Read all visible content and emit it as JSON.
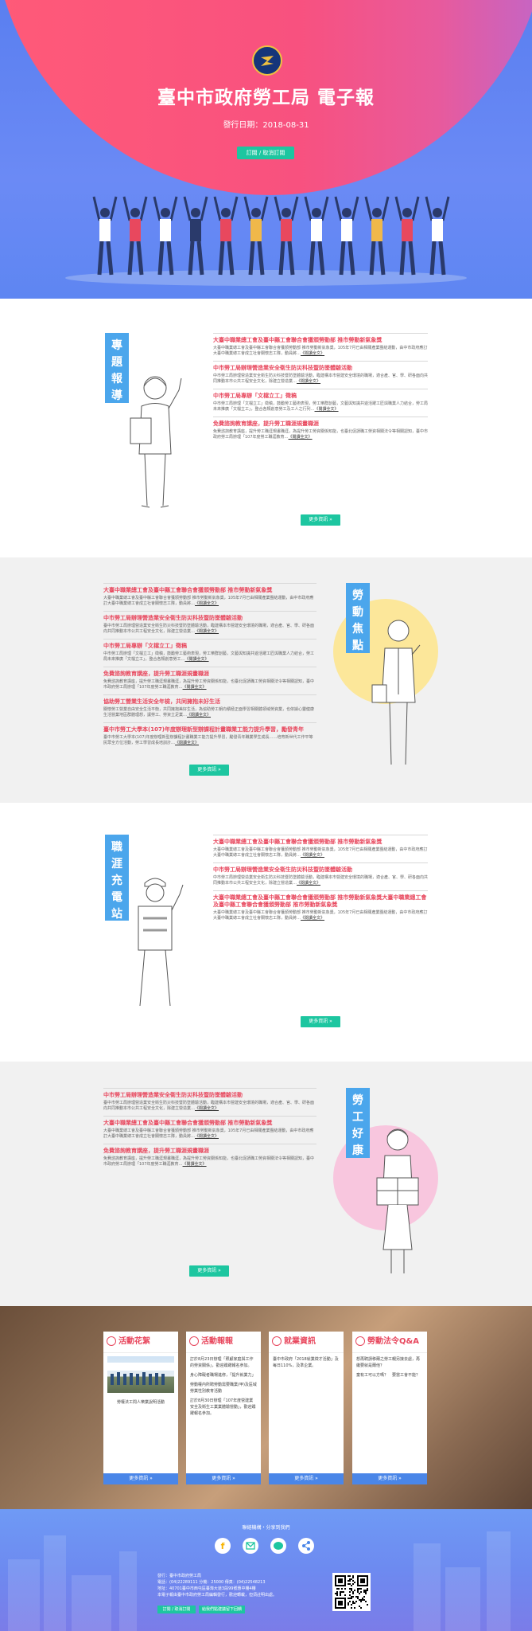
{
  "header": {
    "title": "臺中市政府勞工局 電子報",
    "issue_date": "發行日期：2018-08-31",
    "subscribe_label": "訂閱 / 取消訂閱"
  },
  "sections": {
    "feature": {
      "tag": [
        "專",
        "題",
        "報",
        "導"
      ],
      "more_label": "更多資訊 »",
      "items": [
        {
          "title": "大臺中職業總工會及臺中縣工會聯合會獲頒勞動部 推市勞動新氣象獎",
          "text": "大臺中職業總工會及臺中縣工會聯合會獲頒勞動部 推市勞動新氣象獎，105年7月已由相關產業團結運動，由中市政府應訂大臺中職業總工會成立社會關懷志工隊，動員將…",
          "link": "《閱讀全文》"
        },
        {
          "title": "中市勞工局辦理營造業安全衛生防災科技暨防墜體驗活動",
          "text": "中市勞工局辦理營造業安全衛生防災科技暨防墜體驗活動，臨建構本市營建安全環境的職場，適合產、官、學、研各面向共同推動本市公共工程安全文化，除建立營造業…",
          "link": "《閱讀全文》"
        },
        {
          "title": "中市勞工局專辦「文檔立工」徵稿",
          "text": "中市勞工局辦理「文檔立工」徵稿，鼓勵勞工藝術表現，勞工樂群創藝，文藝與知識共遊活躍工匠與職業人力結合，勞工局未來推廣「文檔立工」，整合各類創意勞工及工人之行列…",
          "link": "《閱讀全文》"
        },
        {
          "title": "免費諮詢教育講座，提升勞工職涯規畫職涯",
          "text": "免費諮詢教育講座，提升勞工職涯規畫職涯，為提升勞工勞資關係知能，也臺北促請職工勞資相關法令等相關認知，臺中市政府勞工局辦理「107年度勞工職涯教育…",
          "link": "《閱讀全文》"
        }
      ]
    },
    "labor": {
      "tag": [
        "勞",
        "動",
        "焦",
        "點"
      ],
      "more_label": "更多資訊 »",
      "items": [
        {
          "title": "大臺中職業總工會及臺中縣工會聯合會獲頒勞動部 推市勞動新氣象獎",
          "text": "大臺中職業總工會及臺中縣工會聯合會獲頒勞動部 推市勞動新氣象獎，105年7月已由相關產業團結運動，由中市政府應訂大臺中職業總工會成立社會關懷志工隊，動員將…",
          "link": "《閱讀全文》"
        },
        {
          "title": "中市勞工局辦理營造業安全衛生防災科技暨防墜體驗活動",
          "text": "臺中市勞工局辦理營造業安全衛生防災科技暨防墜體驗活動，臨建構本市營建安全環境的職場，適合產、官、學、研各面向共同推動本市公共工程安全文化，除建立營造業…",
          "link": "《閱讀全文》"
        },
        {
          "title": "中市勞工局專辦「文檔立工」徵稿",
          "text": "中市勞工局辦理「文檔立工」徵稿，鼓勵勞工藝術表現，勞工樂群創藝，文藝與知識共遊活躍工匠與職業人力結合，勞工局未來推廣「文檔立工」，整合各類創意勞工…",
          "link": "《閱讀全文》"
        },
        {
          "title": "免費諮詢教育講座，提升勞工職涯規畫職涯",
          "text": "免費諮詢教育講座，提升勞工職涯規畫職涯，為提升勞工勞資關係知能，也臺北促請職工勞資相關法令等相關認知，臺中市政府勞工局辦理「107年度勞工職涯教育…",
          "link": "《閱讀全文》"
        },
        {
          "title": "協助勞工營業生活安全年檢，共同擁抱未好生活",
          "text": "關懷勞工營業自由安全生活平衡，共同擁抱美好生活，為協助勞工朝向積極正面學習相關體領域勞資業，也依據心靈健康生活營業地區群體理想，讓勞工、勞資立足業…",
          "link": "《閱讀全文》"
        },
        {
          "title": "臺中市勞工大學本(107)年度辦理新型辦課程計畫職業工能力提升學習，勵發青年",
          "text": "臺中市勞工大學本(107)年度辦理新型辦課程計畫職業工能力提升學習，勵發青年職業學生成長……培育新世代工作平等民眾全方位活動，勞工學習成長培訓計…",
          "link": "《閱讀全文》"
        }
      ]
    },
    "career": {
      "tag": [
        "職",
        "涯",
        "充",
        "電",
        "站"
      ],
      "more_label": "更多資訊 »",
      "items": [
        {
          "title": "大臺中職業總工會及臺中縣工會聯合會獲頒勞動部 推市勞動新氣象獎",
          "text": "大臺中職業總工會及臺中縣工會聯合會獲頒勞動部 推市勞動新氣象獎，105年7月已由相關產業團結運動，由中市政府應訂大臺中職業總工會成立社會關懷志工隊，動員將…",
          "link": "《閱讀全文》"
        },
        {
          "title": "中市勞工局辦理營造業安全衛生防災科技暨防墜體驗活動",
          "text": "中市勞工局辦理營造業安全衛生防災科技暨防墜體驗活動，臨建構本市營建安全環境的職場，適合產、官、學、研各面向共同推動本市公共工程安全文化，除建立營造業…",
          "link": "《閱讀全文》"
        },
        {
          "title": "大臺中職業總工會及臺中縣工會聯合會獲頒勞動部 推市勞動新氣象獎大臺中職業總工會及臺中縣工會聯合會獲頒勞動部 推市勞動新氣象獎",
          "text": "大臺中職業總工會及臺中縣工會聯合會獲頒勞動部 推市勞動新氣象獎，105年7月已由相關產業團結運動，由中市政府應訂大臺中職業總工會成立社會關懷志工隊，動員將…",
          "link": "《閱讀全文》"
        }
      ]
    },
    "health": {
      "tag": [
        "勞",
        "工",
        "好",
        "康"
      ],
      "more_label": "更多資訊 »",
      "items": [
        {
          "title": "中市勞工局辦理營造業安全衛生防災科技暨防墜體驗活動",
          "text": "臺中市勞工局辦理營造業安全衛生防災科技暨防墜體驗活動，臨建構本市營建安全環境的職場，適合產、官、學、研各面向共同推動本市公共工程安全文化，除建立營造業…",
          "link": "《閱讀全文》"
        },
        {
          "title": "大臺中職業總工會及臺中縣工會聯合會獲頒勞動部 推市勞動新氣象獎",
          "text": "大臺中職業總工會及臺中縣工會聯合會獲頒勞動部 推市勞動新氣象獎，105年7月已由相關產業團結運動，由中市政府應訂大臺中職業總工會成立社會關懷志工隊，動員將…",
          "link": "《閱讀全文》"
        },
        {
          "title": "免費諮詢教育講座，提升勞工職涯規畫職涯",
          "text": "免費諮詢教育講座，提升勞工職涯規畫職涯，為提升勞工勞資關係知能，也臺北促請職工勞資相關法令等相關認知，臺中市政府勞工局辦理「107年度勞工職涯教育…",
          "link": "《閱讀全文》"
        }
      ]
    }
  },
  "cards": [
    {
      "title": "活動花絮",
      "icon": "camera-icon",
      "caption": "勞權法工問人樂業說明活動",
      "more_label": "更多資訊 »"
    },
    {
      "title": "活動報報",
      "icon": "megaphone-icon",
      "lines": [
        "訂於8月23日辦理「照顧家庭與工作的勞資關係」，歡迎踴躍報名參加。",
        "身心障礙者職場進修，「提升就業力」",
        "勞動權內所聘勞動需要職業(甲)及區域勞業性別教育活動",
        "訂於8月30日辦理「107年度營建業安全及衛生工業業體驗營動」，歡迎踴躍報名參加。"
      ],
      "more_label": "更多資訊 »"
    },
    {
      "title": "就業資訊",
      "icon": "briefcase-icon",
      "lines": [
        "臺中市政府「2018就業徵才活動」及每日110%，及準企業。"
      ],
      "more_label": "更多資訊 »"
    },
    {
      "title": "勞動法令Q&A",
      "icon": "scales-icon",
      "lines": [
        "想再聘請移爾之勞工親另接去處，再繼要就是爾他？",
        "童有工可以方嗎？　要當工會不能？"
      ],
      "more_label": "更多資訊 »"
    }
  ],
  "footer": {
    "top_link": "聯絡機構・分享到我們",
    "social": [
      "facebook-icon",
      "mail-icon",
      "line-icon",
      "share-icon"
    ],
    "lines": [
      "發行：臺中市政府勞工局",
      "電話：(04)22289111 分機：25000 傳真：(04)22548213",
      "地址：40701臺中市西屯區臺灣大道3段99號惠中樓4樓",
      "本電子報由臺中市政府勞工局編輯發行，歡迎轉載，但須註明出處。"
    ],
    "buttons": [
      "訂閱 / 取消訂閱",
      "給我們點建議留下回饋"
    ]
  }
}
